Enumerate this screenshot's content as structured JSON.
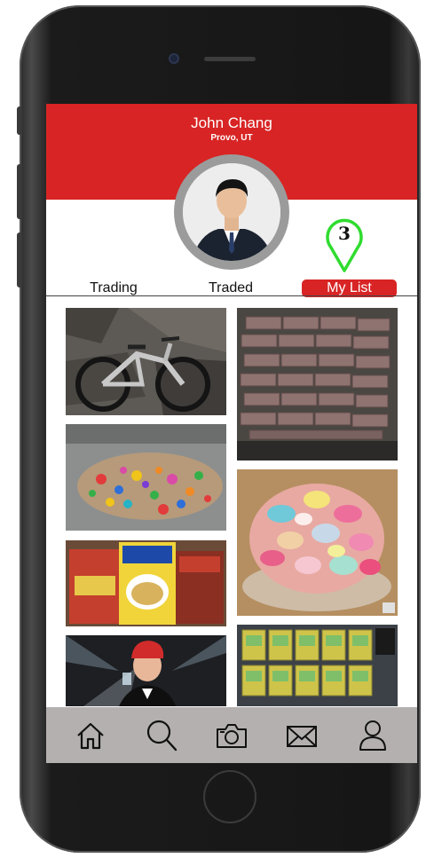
{
  "profile": {
    "name": "John Chang",
    "location": "Provo, UT",
    "annotation_number": "3"
  },
  "tabs": [
    {
      "label": "Trading",
      "active": false
    },
    {
      "label": "Traded",
      "active": false
    },
    {
      "label": "My List",
      "active": true
    }
  ],
  "list_items": [
    {
      "name": "mountain-bike-photo"
    },
    {
      "name": "brick-pile-photo"
    },
    {
      "name": "toy-pile-photo"
    },
    {
      "name": "flower-petals-bowl-photo"
    },
    {
      "name": "cereal-boxes-photo"
    },
    {
      "name": "party-man-photo"
    },
    {
      "name": "trading-cards-photo"
    }
  ],
  "nav": [
    {
      "icon": "home-icon"
    },
    {
      "icon": "search-icon"
    },
    {
      "icon": "camera-icon"
    },
    {
      "icon": "mail-icon"
    },
    {
      "icon": "profile-icon"
    }
  ],
  "colors": {
    "accent": "#d82424",
    "navbar": "#b5b0b0",
    "marker": "#2fdc2f"
  }
}
